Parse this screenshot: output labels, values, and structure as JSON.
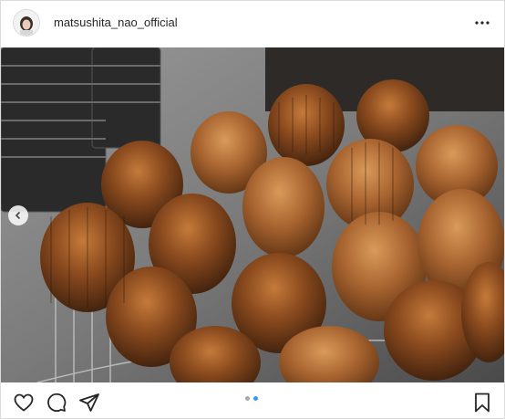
{
  "post": {
    "username": "matsushita_nao_official",
    "carousel": {
      "slides": 2,
      "current_slide": 2
    }
  },
  "icons": {
    "more": "more-options-icon",
    "like": "heart-icon",
    "comment": "comment-bubble-icon",
    "share": "paper-plane-icon",
    "save": "bookmark-icon",
    "prev": "chevron-left-icon"
  },
  "colors": {
    "text": "#262626",
    "border": "#dbdbdb",
    "carousel_active": "#3897f0",
    "carousel_inactive": "#a8a8a8"
  }
}
